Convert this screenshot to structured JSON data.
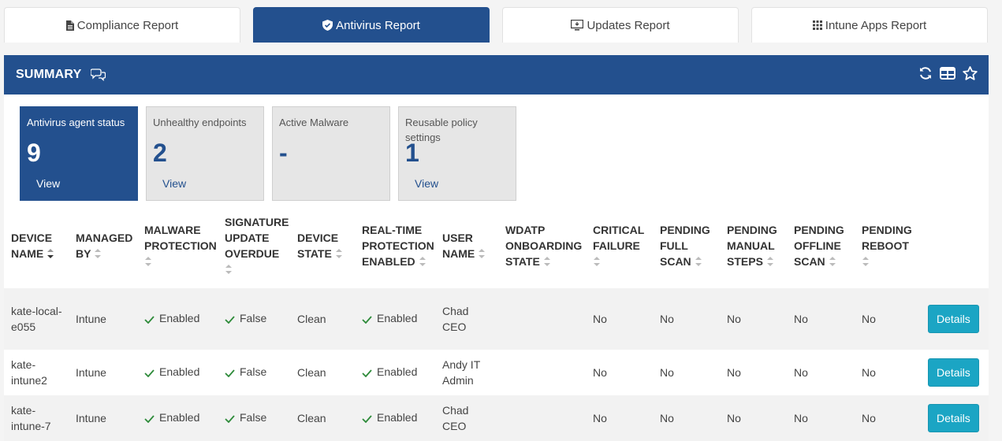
{
  "tabs": [
    {
      "label": "Compliance Report",
      "icon": "document-icon",
      "active": false
    },
    {
      "label": "Antivirus Report",
      "icon": "shield-check-icon",
      "active": true
    },
    {
      "label": "Updates Report",
      "icon": "monitor-update-icon",
      "active": false
    },
    {
      "label": "Intune Apps Report",
      "icon": "grid-icon",
      "active": false
    }
  ],
  "summary": {
    "title": "SUMMARY",
    "icons": [
      "chat-icon",
      "refresh-icon",
      "table-view-icon",
      "star-icon"
    ]
  },
  "cards": [
    {
      "label": "Antivirus agent status",
      "value": "9",
      "link": "View",
      "active": true
    },
    {
      "label": "Unhealthy endpoints",
      "value": "2",
      "link": "View",
      "active": false
    },
    {
      "label": "Active Malware",
      "value": "-",
      "link": "",
      "active": false
    },
    {
      "label": "Reusable policy settings",
      "value": "1",
      "link": "View",
      "active": false
    }
  ],
  "table": {
    "headers": [
      "DEVICE NAME",
      "MANAGED BY",
      "MALWARE PROTECTION",
      "SIGNATURE UPDATE OVERDUE",
      "DEVICE STATE",
      "REAL-TIME PROTECTION ENABLED",
      "USER NAME",
      "WDATP ONBOARDING STATE",
      "CRITICAL FAILURE",
      "PENDING FULL SCAN",
      "PENDING MANUAL STEPS",
      "PENDING OFFLINE SCAN",
      "PENDING REBOOT"
    ],
    "rows": [
      {
        "device": "kate-local-e055",
        "managed": "Intune",
        "malware": "Enabled",
        "signature": "False",
        "state": "Clean",
        "realtime": "Enabled",
        "user": "Chad CEO",
        "wdatp": "",
        "critical": "No",
        "fullscan": "No",
        "manual": "No",
        "offline": "No",
        "reboot": "No",
        "action": "Details"
      },
      {
        "device": "kate-intune2",
        "managed": "Intune",
        "malware": "Enabled",
        "signature": "False",
        "state": "Clean",
        "realtime": "Enabled",
        "user": "Andy IT Admin",
        "wdatp": "",
        "critical": "No",
        "fullscan": "No",
        "manual": "No",
        "offline": "No",
        "reboot": "No",
        "action": "Details"
      },
      {
        "device": "kate-intune-7",
        "managed": "Intune",
        "malware": "Enabled",
        "signature": "False",
        "state": "Clean",
        "realtime": "Enabled",
        "user": "Chad CEO",
        "wdatp": "",
        "critical": "No",
        "fullscan": "No",
        "manual": "No",
        "offline": "No",
        "reboot": "No",
        "action": "Details"
      }
    ]
  },
  "colors": {
    "primary": "#23508e",
    "button": "#1ba5c4",
    "check": "#2e8b3a"
  }
}
